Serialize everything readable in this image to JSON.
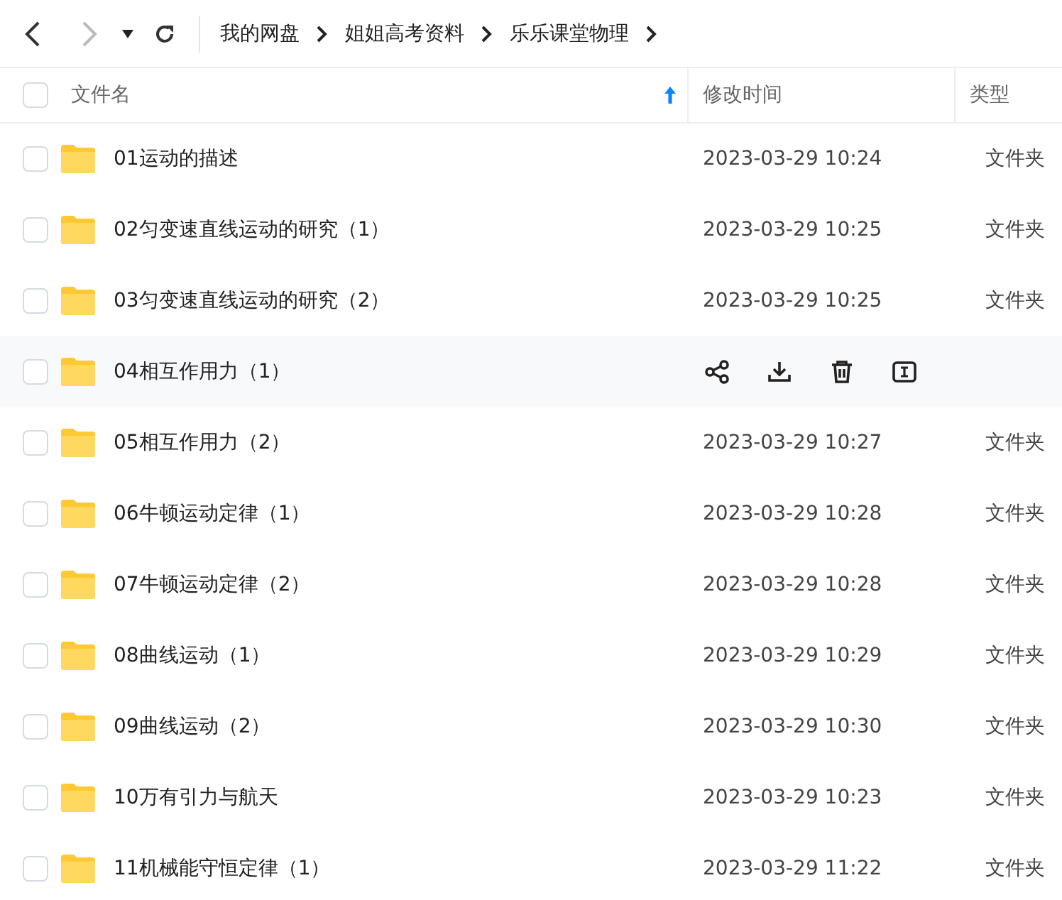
{
  "toolbar": {
    "back_enabled": true,
    "forward_enabled": false
  },
  "breadcrumb": [
    "我的网盘",
    "姐姐高考资料",
    "乐乐课堂物理"
  ],
  "table": {
    "columns": [
      {
        "label": "文件名",
        "sorted": true
      },
      {
        "label": "修改时间",
        "sorted": false
      },
      {
        "label": "类型",
        "sorted": false
      }
    ],
    "select_all_checked": false,
    "rows": [
      {
        "name": "01运动的描述",
        "modified": "2023-03-29 10:24",
        "type": "文件夹",
        "hovered": false
      },
      {
        "name": "02匀变速直线运动的研究（1）",
        "modified": "2023-03-29 10:25",
        "type": "文件夹",
        "hovered": false
      },
      {
        "name": "03匀变速直线运动的研究（2）",
        "modified": "2023-03-29 10:25",
        "type": "文件夹",
        "hovered": false
      },
      {
        "name": "04相互作用力（1）",
        "hovered": true
      },
      {
        "name": "05相互作用力（2）",
        "modified": "2023-03-29 10:27",
        "type": "文件夹",
        "hovered": false
      },
      {
        "name": "06牛顿运动定律（1）",
        "modified": "2023-03-29 10:28",
        "type": "文件夹",
        "hovered": false
      },
      {
        "name": "07牛顿运动定律（2）",
        "modified": "2023-03-29 10:28",
        "type": "文件夹",
        "hovered": false
      },
      {
        "name": "08曲线运动（1）",
        "modified": "2023-03-29 10:29",
        "type": "文件夹",
        "hovered": false
      },
      {
        "name": "09曲线运动（2）",
        "modified": "2023-03-29 10:30",
        "type": "文件夹",
        "hovered": false
      },
      {
        "name": "10万有引力与航天",
        "modified": "2023-03-29 10:23",
        "type": "文件夹",
        "hovered": false
      },
      {
        "name": "11机械能守恒定律（1）",
        "modified": "2023-03-29 11:22",
        "type": "文件夹",
        "hovered": false
      }
    ]
  }
}
